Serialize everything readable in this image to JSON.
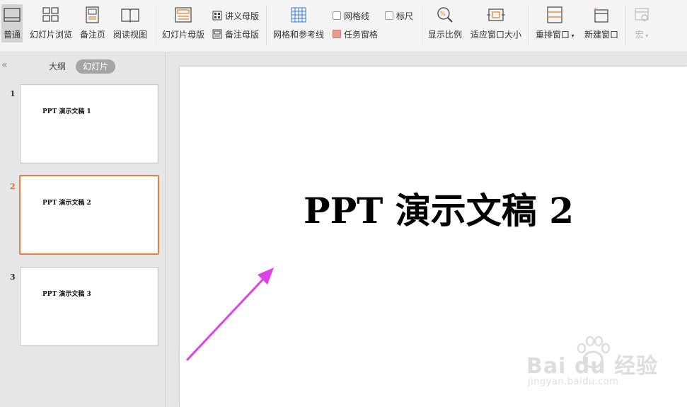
{
  "ribbon": {
    "normal": "普通",
    "slide_sorter": "幻灯片浏览",
    "notes_page": "备注页",
    "reading_view": "阅读视图",
    "slide_master": "幻灯片母版",
    "handout_master": "讲义母版",
    "notes_master": "备注母版",
    "grid_guides": "网格和参考线",
    "gridlines": "网格线",
    "ruler": "标尺",
    "task_pane": "任务窗格",
    "zoom": "显示比例",
    "fit_window": "适应窗口大小",
    "arrange_all": "重排窗口",
    "new_window": "新建窗口",
    "macro": "宏"
  },
  "checkboxes": {
    "gridlines": false,
    "ruler": false,
    "task_pane": true
  },
  "left_pane": {
    "collapse": "«",
    "tab_outline": "大纲",
    "tab_slides": "幻灯片",
    "thumbnails": [
      {
        "number": "1",
        "title": "PPT 演示文稿 1",
        "selected": false
      },
      {
        "number": "2",
        "title": "PPT 演示文稿 2",
        "selected": true
      },
      {
        "number": "3",
        "title": "PPT 演示文稿 3",
        "selected": false
      }
    ]
  },
  "slide": {
    "title": "PPT 演示文稿 2"
  },
  "annotation": {
    "arrow_color": "#e040e8"
  },
  "watermark": {
    "text": "Bai du 经验",
    "url": "jingyan.baidu.com"
  },
  "colors": {
    "accent": "#e8823f",
    "ribbon_bg": "#f4f4f4",
    "pane_bg": "#e6e6e6"
  }
}
